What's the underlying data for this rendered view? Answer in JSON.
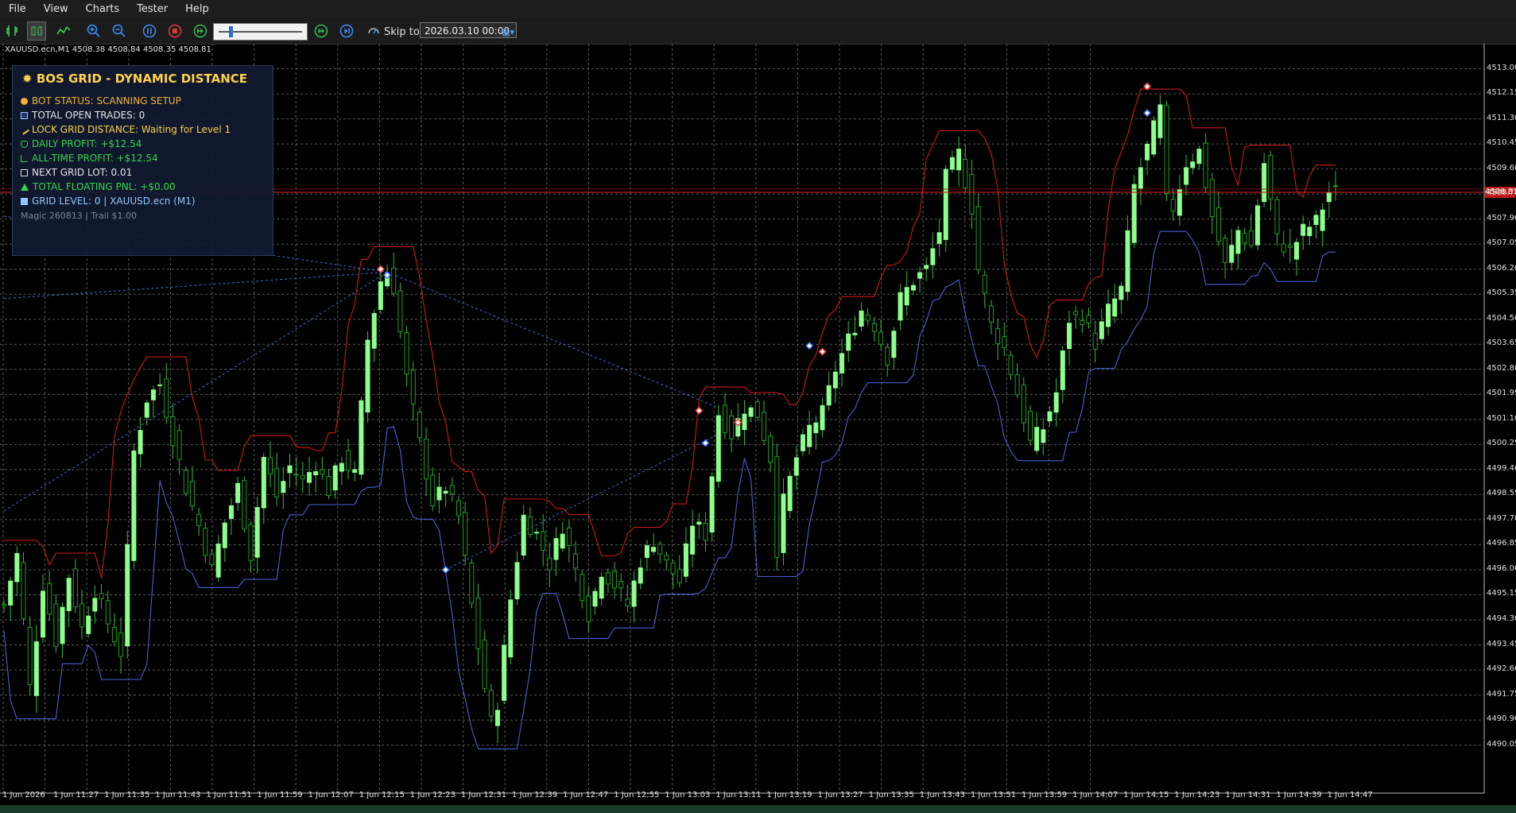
{
  "menu": {
    "items": [
      "File",
      "View",
      "Charts",
      "Tester",
      "Help"
    ]
  },
  "toolbar": {
    "skip_to_label": "Skip to",
    "date_value": "2026.03.10 00:00",
    "slider_level": 0.18,
    "icons": [
      "candles-icon",
      "bars-icon",
      "line-chart-icon",
      "zoom-in-icon",
      "zoom-out-icon",
      "pause-icon",
      "stop-icon",
      "fast-forward-icon",
      "play-speed-icon",
      "skip-end-icon",
      "skip-to-icon",
      "calendar-icon"
    ]
  },
  "chart": {
    "symbol_header": "XAUUSD.ecn,M1  4508.38  4508.84  4508.35  4508.81",
    "current_price": "4508.81",
    "colors": {
      "background": "#000000",
      "grid": "#5a5a5a",
      "bull": "#8cff8c",
      "bear": "#1e9e1e",
      "upper_band": "#cc1a1a",
      "lower_band": "#4a5fd0",
      "price_line": "#d01e1e"
    }
  },
  "panel": {
    "title": "BOS GRID - DYNAMIC DISTANCE",
    "rows": [
      {
        "text": "BOT STATUS: SCANNING SETUP",
        "color": "#f2b233",
        "icon": "status-dot-icon"
      },
      {
        "text": "TOTAL OPEN TRADES: 0",
        "color": "#e6e6e6",
        "icon": "trades-icon"
      },
      {
        "text": "LOCK GRID DISTANCE: Waiting for Level 1",
        "color": "#ffd24a",
        "icon": "ruler-icon"
      },
      {
        "text": "DAILY PROFIT: +$12.54",
        "color": "#33d64d",
        "icon": "money-icon"
      },
      {
        "text": "ALL-TIME PROFIT: +$12.54",
        "color": "#33d64d",
        "icon": "chart-icon"
      },
      {
        "text": "NEXT GRID LOT: 0.01",
        "color": "#e6e6e6",
        "icon": "lot-icon"
      },
      {
        "text": "TOTAL FLOATING PNL: +$0.00",
        "color": "#33d64d",
        "icon": "trend-up-icon"
      },
      {
        "text": "GRID LEVEL: 0 | XAUUSD.ecn (M1)",
        "color": "#8fc8ff",
        "icon": "grid-icon"
      }
    ],
    "footer": "Magic 260813 | Trail $1.00"
  },
  "chart_data": {
    "type": "candlestick",
    "symbol": "XAUUSD.ecn",
    "timeframe": "M1",
    "y_ticks": [
      "4513.00",
      "4512.15",
      "4511.30",
      "4510.45",
      "4509.60",
      "4508.75",
      "4507.90",
      "4507.05",
      "4506.20",
      "4505.35",
      "4504.50",
      "4503.65",
      "4502.80",
      "4501.95",
      "4501.10",
      "4500.25",
      "4499.40",
      "4498.55",
      "4497.70",
      "4496.85",
      "4496.00",
      "4495.15",
      "4494.30",
      "4493.45",
      "4492.60",
      "4491.75",
      "4490.90",
      "4490.05"
    ],
    "x_ticks": [
      "1 Jun 2026",
      "1 Jun 11:27",
      "1 Jun 11:35",
      "1 Jun 11:43",
      "1 Jun 11:51",
      "1 Jun 11:59",
      "1 Jun 12:07",
      "1 Jun 12:15",
      "1 Jun 12:23",
      "1 Jun 12:31",
      "1 Jun 12:39",
      "1 Jun 12:47",
      "1 Jun 12:55",
      "1 Jun 13:03",
      "1 Jun 13:11",
      "1 Jun 13:19",
      "1 Jun 13:27",
      "1 Jun 13:35",
      "1 Jun 13:43",
      "1 Jun 13:51",
      "1 Jun 13:59",
      "1 Jun 14:07",
      "1 Jun 14:15",
      "1 Jun 14:23",
      "1 Jun 14:31",
      "1 Jun 14:39",
      "1 Jun 14:47"
    ],
    "ylim": [
      4489.5,
      4513.5
    ],
    "current_price": 4508.81,
    "close_path": [
      [
        0,
        4494.8
      ],
      [
        2,
        4496.5
      ],
      [
        4,
        4492.0
      ],
      [
        6,
        4495.5
      ],
      [
        8,
        4493.6
      ],
      [
        10,
        4495.8
      ],
      [
        12,
        4494.0
      ],
      [
        14,
        4495.3
      ],
      [
        16,
        4494.2
      ],
      [
        18,
        4493.2
      ],
      [
        20,
        4500.0
      ],
      [
        22,
        4501.8
      ],
      [
        24,
        4502.3
      ],
      [
        26,
        4500.5
      ],
      [
        28,
        4498.8
      ],
      [
        30,
        4497.5
      ],
      [
        32,
        4496.0
      ],
      [
        34,
        4497.6
      ],
      [
        36,
        4498.8
      ],
      [
        38,
        4496.5
      ],
      [
        40,
        4499.8
      ],
      [
        42,
        4498.5
      ],
      [
        44,
        4499.5
      ],
      [
        46,
        4499.0
      ],
      [
        48,
        4499.6
      ],
      [
        50,
        4498.7
      ],
      [
        52,
        4499.8
      ],
      [
        54,
        4499.2
      ],
      [
        56,
        4503.8
      ],
      [
        58,
        4505.8
      ],
      [
        59,
        4506.1
      ],
      [
        60,
        4505.6
      ],
      [
        62,
        4502.5
      ],
      [
        64,
        4500.3
      ],
      [
        66,
        4498.3
      ],
      [
        68,
        4498.8
      ],
      [
        70,
        4497.8
      ],
      [
        72,
        4494.8
      ],
      [
        74,
        4492.0
      ],
      [
        75,
        4490.8
      ],
      [
        76,
        4491.5
      ],
      [
        78,
        4495.0
      ],
      [
        80,
        4497.8
      ],
      [
        82,
        4497.2
      ],
      [
        84,
        4496.2
      ],
      [
        86,
        4497.5
      ],
      [
        88,
        4496.0
      ],
      [
        90,
        4494.5
      ],
      [
        92,
        4496.0
      ],
      [
        94,
        4495.5
      ],
      [
        96,
        4494.8
      ],
      [
        98,
        4496.3
      ],
      [
        100,
        4497.0
      ],
      [
        102,
        4496.2
      ],
      [
        104,
        4495.6
      ],
      [
        106,
        4497.6
      ],
      [
        108,
        4497.2
      ],
      [
        110,
        4501.3
      ],
      [
        112,
        4500.6
      ],
      [
        114,
        4501.5
      ],
      [
        116,
        4501.3
      ],
      [
        118,
        4499.8
      ],
      [
        119,
        4496.7
      ],
      [
        120,
        4498.3
      ],
      [
        122,
        4499.8
      ],
      [
        124,
        4500.8
      ],
      [
        126,
        4501.3
      ],
      [
        128,
        4502.8
      ],
      [
        130,
        4503.8
      ],
      [
        132,
        4504.8
      ],
      [
        134,
        4504.3
      ],
      [
        136,
        4503.2
      ],
      [
        138,
        4505.2
      ],
      [
        140,
        4505.8
      ],
      [
        142,
        4506.2
      ],
      [
        144,
        4507.5
      ],
      [
        145,
        4509.3
      ],
      [
        147,
        4510.1
      ],
      [
        149,
        4508.3
      ],
      [
        150,
        4506.2
      ],
      [
        152,
        4504.3
      ],
      [
        154,
        4503.5
      ],
      [
        156,
        4502.0
      ],
      [
        158,
        4500.3
      ],
      [
        160,
        4500.8
      ],
      [
        162,
        4502.0
      ],
      [
        164,
        4504.5
      ],
      [
        166,
        4504.6
      ],
      [
        168,
        4503.7
      ],
      [
        170,
        4504.8
      ],
      [
        172,
        4505.5
      ],
      [
        174,
        4509.0
      ],
      [
        176,
        4510.3
      ],
      [
        178,
        4511.6
      ],
      [
        179,
        4508.5
      ],
      [
        180,
        4508.3
      ],
      [
        182,
        4509.8
      ],
      [
        184,
        4510.2
      ],
      [
        186,
        4508.0
      ],
      [
        188,
        4506.3
      ],
      [
        190,
        4507.5
      ],
      [
        192,
        4507.0
      ],
      [
        194,
        4509.8
      ],
      [
        196,
        4507.2
      ],
      [
        198,
        4506.8
      ],
      [
        200,
        4507.5
      ],
      [
        202,
        4507.8
      ],
      [
        204,
        4508.8
      ]
    ],
    "markers": [
      {
        "bar": 58,
        "price": 4506.2,
        "color": "#ff4040"
      },
      {
        "bar": 59,
        "price": 4506.0,
        "color": "#3a6fff"
      },
      {
        "bar": 68,
        "price": 4496.0,
        "color": "#3a6fff"
      },
      {
        "bar": 107,
        "price": 4501.4,
        "color": "#ff4040"
      },
      {
        "bar": 108,
        "price": 4500.3,
        "color": "#3a6fff"
      },
      {
        "bar": 113,
        "price": 4501.0,
        "color": "#ff4040"
      },
      {
        "bar": 124,
        "price": 4503.6,
        "color": "#3a6fff"
      },
      {
        "bar": 126,
        "price": 4503.4,
        "color": "#ff4040"
      },
      {
        "bar": 176,
        "price": 4512.4,
        "color": "#ff4040"
      },
      {
        "bar": 176,
        "price": 4511.5,
        "color": "#3a6fff"
      }
    ]
  }
}
